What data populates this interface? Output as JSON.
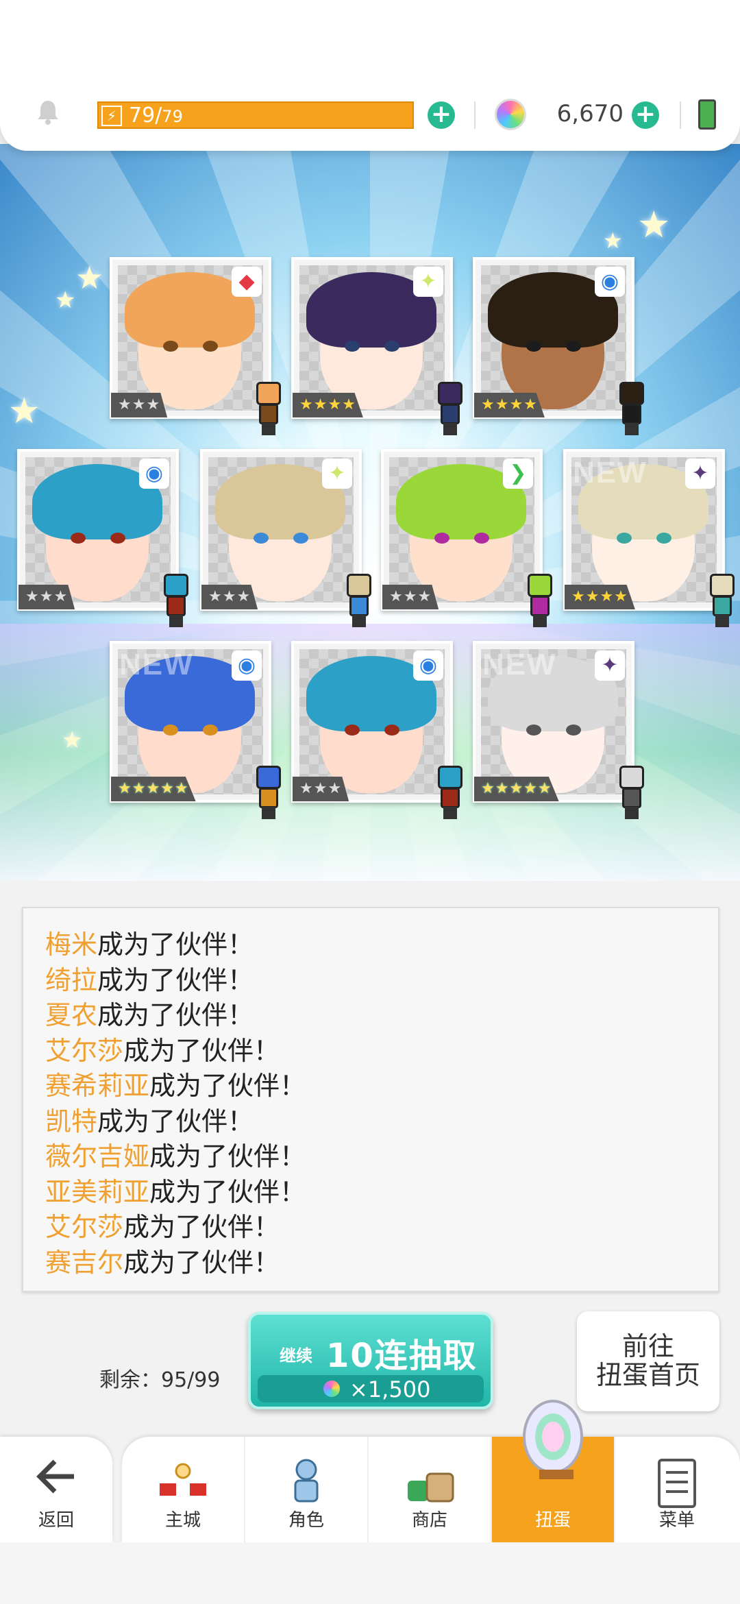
{
  "topbar": {
    "stamina_current": "79",
    "stamina_max": "79",
    "gems": "6,670"
  },
  "cards": [
    {
      "stars": "★★★",
      "rarity": 3,
      "element": "fire-icon",
      "is_new": false
    },
    {
      "stars": "★★★★",
      "rarity": 4,
      "element": "light-icon",
      "is_new": false
    },
    {
      "stars": "★★★★",
      "rarity": 4,
      "element": "water-icon",
      "is_new": false
    },
    {
      "stars": "★★★",
      "rarity": 3,
      "element": "water-icon",
      "is_new": false
    },
    {
      "stars": "★★★",
      "rarity": 3,
      "element": "light-icon",
      "is_new": false
    },
    {
      "stars": "★★★",
      "rarity": 3,
      "element": "wind-icon",
      "is_new": false
    },
    {
      "stars": "★★★★",
      "rarity": 4,
      "element": "dark-icon",
      "is_new": true,
      "new_label": "NEW"
    },
    {
      "stars": "★★★★★",
      "rarity": 5,
      "element": "water-icon",
      "is_new": true,
      "new_label": "NEW"
    },
    {
      "stars": "★★★",
      "rarity": 3,
      "element": "water-icon",
      "is_new": false
    },
    {
      "stars": "★★★★★",
      "rarity": 5,
      "element": "dark-icon",
      "is_new": true,
      "new_label": "NEW"
    }
  ],
  "log": {
    "suffix": "成为了伙伴！",
    "names": [
      "梅米",
      "绮拉",
      "夏农",
      "艾尔莎",
      "赛希莉亚",
      "凯特",
      "薇尔吉娅",
      "亚美莉亚",
      "艾尔莎",
      "赛吉尔"
    ]
  },
  "actions": {
    "remaining_label": "剩余：95/99",
    "continue_label": "继续",
    "pull_label": "10连抽取",
    "cost_label": "×1,500",
    "home_label_line1": "前往",
    "home_label_line2": "扭蛋首页"
  },
  "nav": {
    "back": "返回",
    "tabs": [
      "主城",
      "角色",
      "商店",
      "扭蛋",
      "菜单"
    ],
    "active": "扭蛋"
  },
  "colors": {
    "accent_orange": "#f7a21d",
    "teal": "#27b98f",
    "name_orange": "#f0a030"
  }
}
